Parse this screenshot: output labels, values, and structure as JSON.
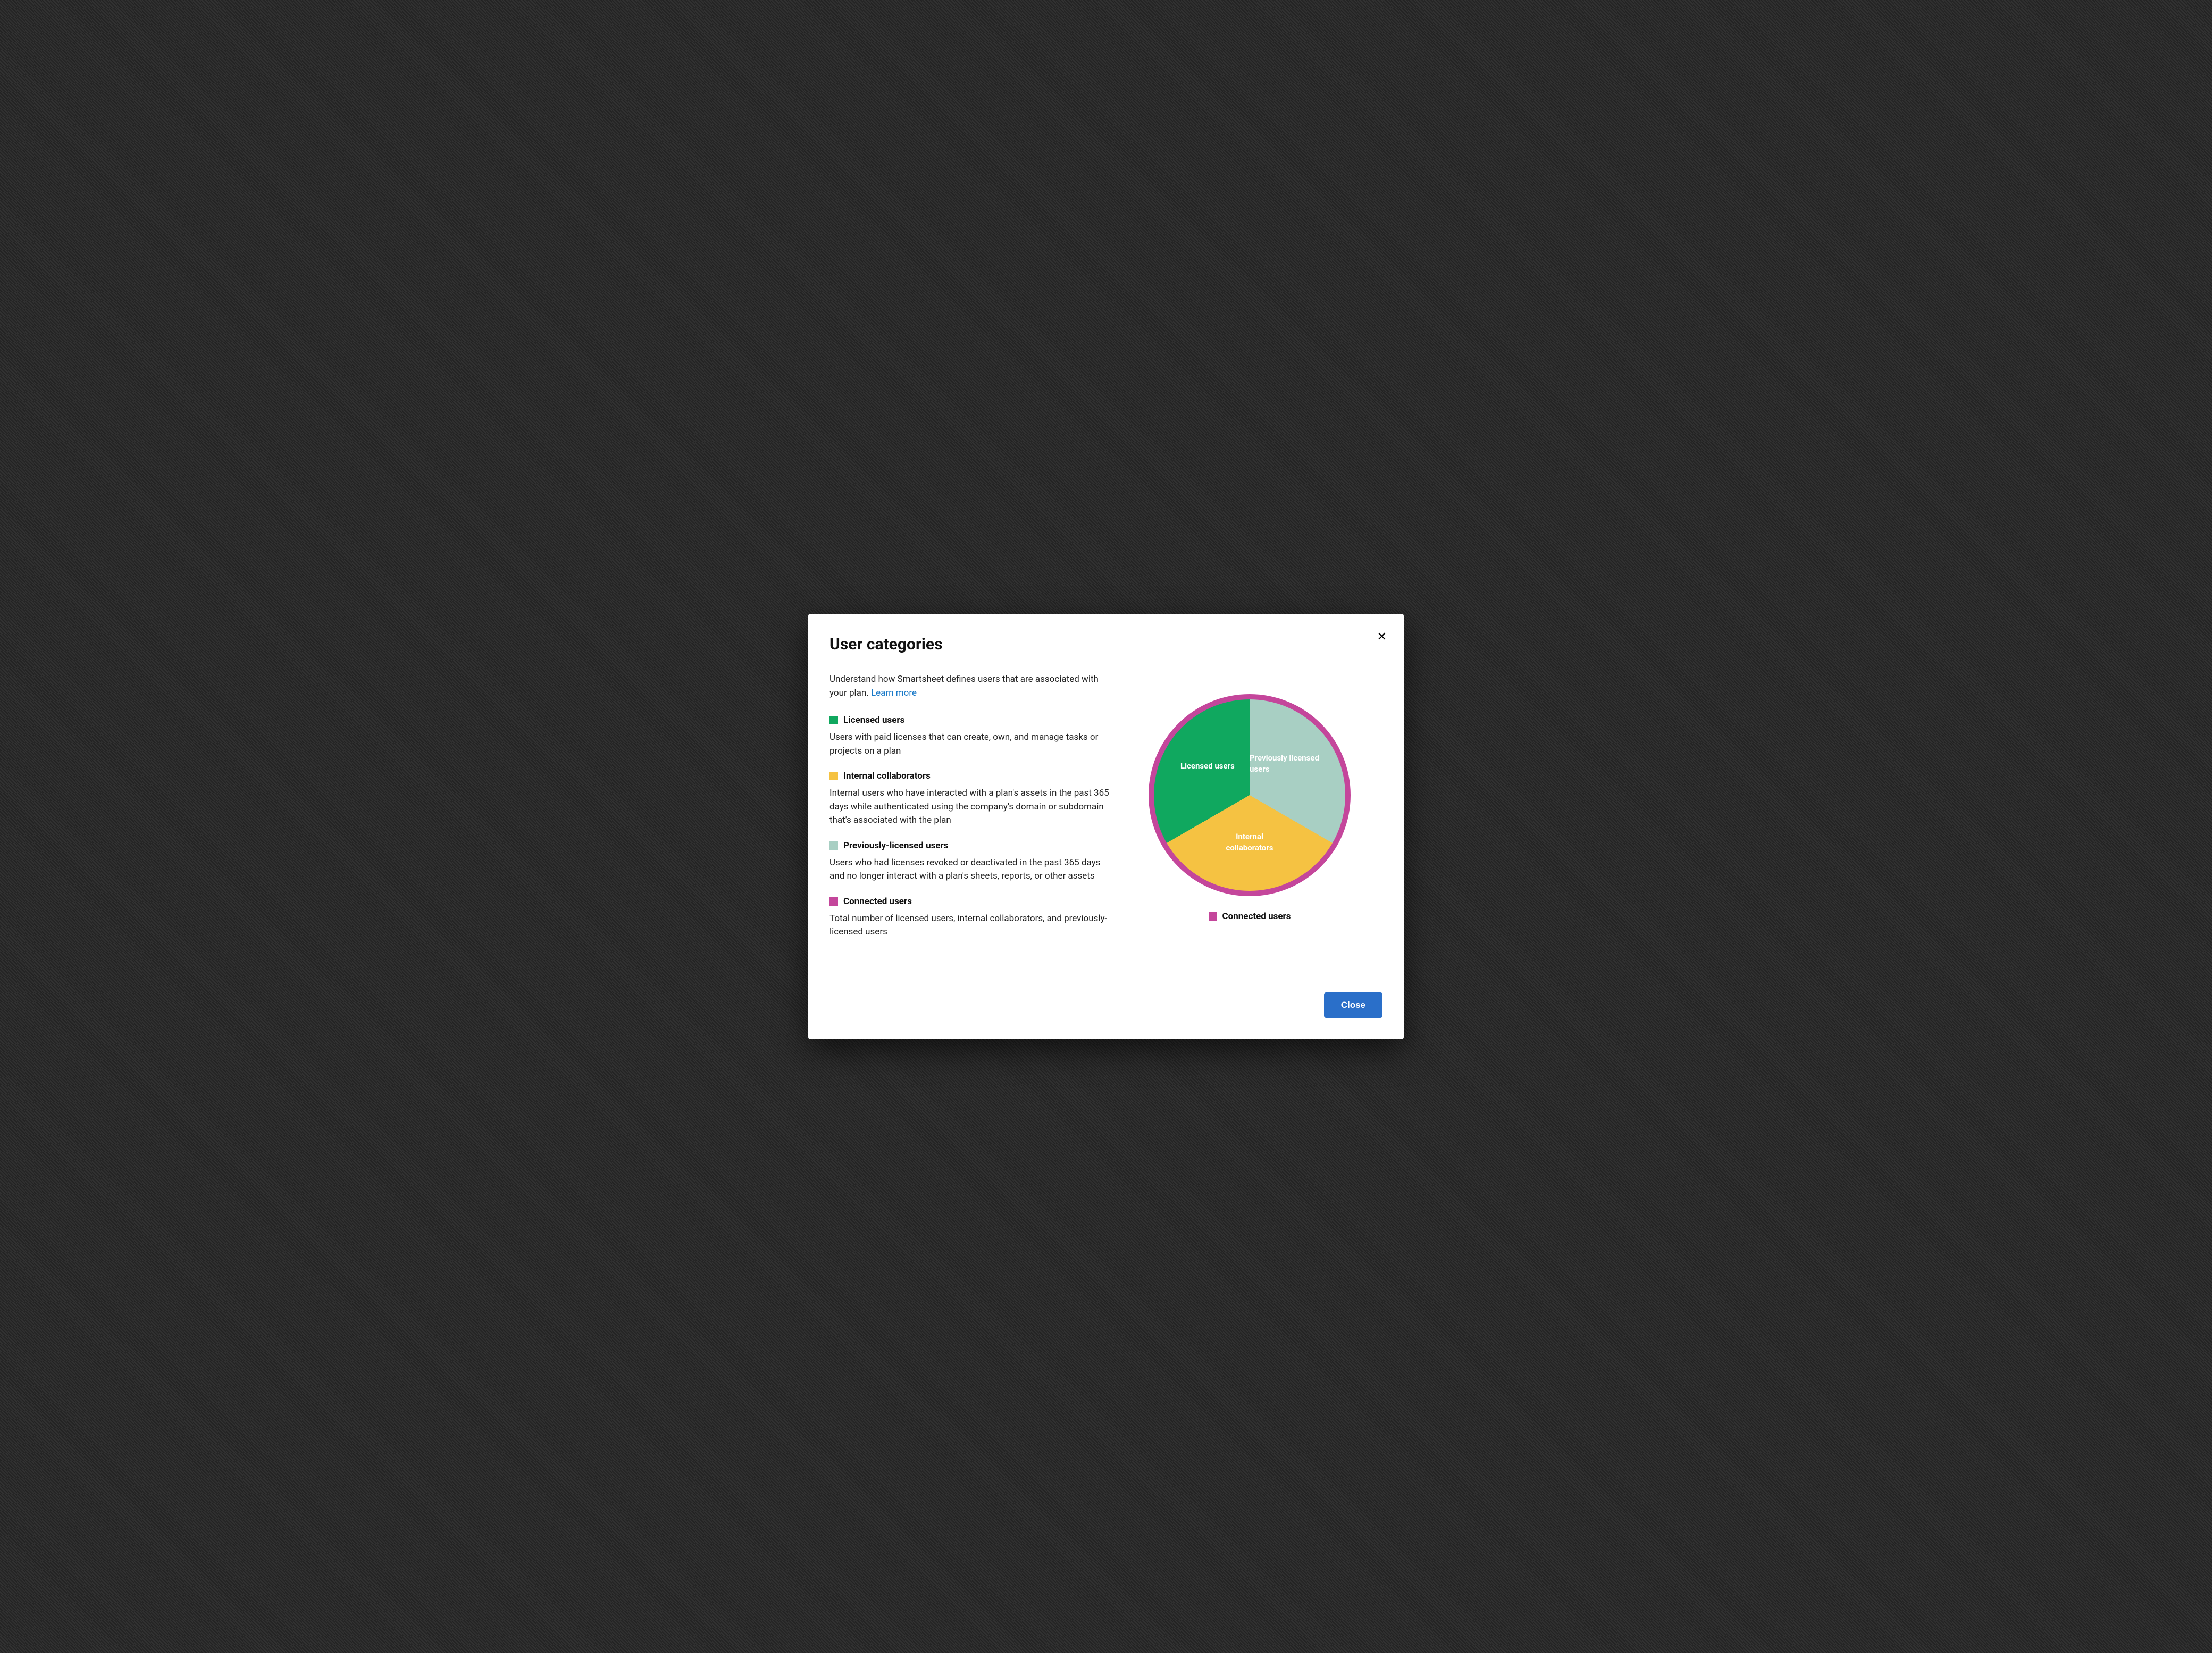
{
  "modal": {
    "title": "User categories",
    "intro": "Understand how Smartsheet defines users that are associated with your plan. ",
    "learn_more": "Learn more",
    "close_button": "Close"
  },
  "categories": [
    {
      "name": "Licensed users",
      "description": "Users with paid licenses that can create, own, and manage tasks or projects on a plan",
      "color": "#10a85f"
    },
    {
      "name": "Internal collaborators",
      "description": "Internal users who have interacted with a plan's assets in the past 365 days while authenticated using the company's domain or subdomain that's associated with the plan",
      "color": "#f5c242"
    },
    {
      "name": "Previously-licensed users",
      "description": "Users who had licenses revoked or deactivated in the past 365 days and no longer interact with a plan's sheets, reports, or other assets",
      "color": "#a8cfc3"
    },
    {
      "name": "Connected users",
      "description": "Total number of licensed users, internal collaborators, and previously-licensed users",
      "color": "#c4469b"
    }
  ],
  "chart_data": {
    "type": "pie",
    "title": "",
    "series": [
      {
        "name": "Licensed users",
        "value": 33.3,
        "color": "#10a85f"
      },
      {
        "name": "Previously licensed users",
        "value": 33.3,
        "color": "#a8cfc3"
      },
      {
        "name": "Internal collaborators",
        "value": 33.3,
        "color": "#f5c242"
      }
    ],
    "outer_ring": {
      "name": "Connected users",
      "color": "#c4469b"
    },
    "legend": "Connected users"
  },
  "chart_labels": {
    "licensed": "Licensed users",
    "previously": "Previously licensed users",
    "internal": "Internal collaborators",
    "connected": "Connected users"
  }
}
